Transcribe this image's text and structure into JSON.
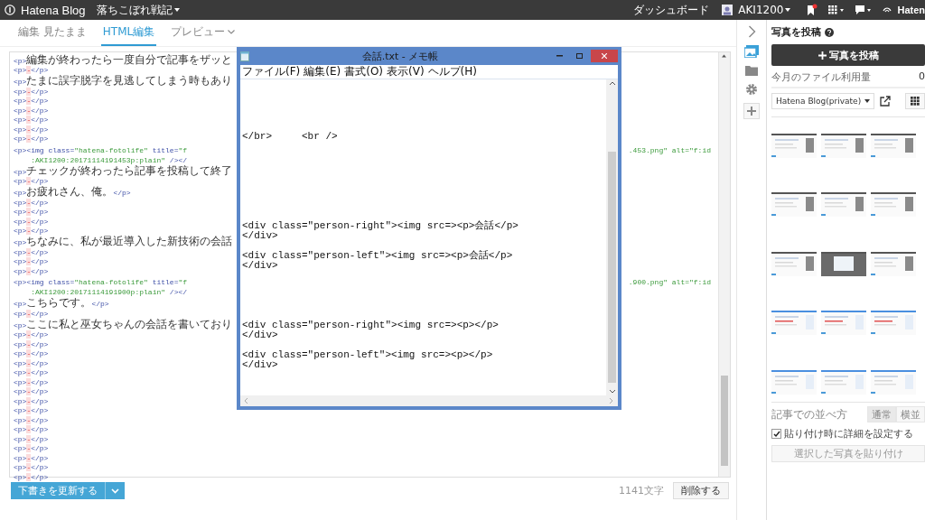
{
  "top_bar": {
    "logo": "Hatena Blog",
    "blog_title": "落ちこぼれ戦記",
    "dashboard": "ダッシュボード",
    "user": "AKI1200",
    "brand": "Haten",
    "notification": true
  },
  "tabs": [
    {
      "label": "編集 見たまま",
      "selected": false,
      "kind": "plain"
    },
    {
      "label": "HTML編集",
      "selected": true,
      "kind": "plain"
    },
    {
      "label": "プレビュー",
      "selected": false,
      "kind": "dropdown"
    }
  ],
  "editor": {
    "lines": [
      {
        "kind": "code",
        "text": "<p>編集が終わったら一度自分で記事をザッと"
      },
      {
        "kind": "blank",
        "text": "<p>-</p>"
      },
      {
        "kind": "code",
        "text": "<p>たまに誤字脱字を見逃してしまう時もあり"
      },
      {
        "kind": "blank",
        "text": "<p>-</p>"
      },
      {
        "kind": "blank",
        "text": "<p>-</p>"
      },
      {
        "kind": "blank",
        "text": "<p>-</p>"
      },
      {
        "kind": "blank",
        "text": "<p>-</p>"
      },
      {
        "kind": "blank",
        "text": "<p>-</p>"
      },
      {
        "kind": "blank",
        "text": "<p>-</p>"
      },
      {
        "kind": "code",
        "text": "<p><img class=\"hatena-fotolife\" title=\"f",
        "tail": ".453.png\" alt=\"f:id"
      },
      {
        "kind": "wrap",
        "text": "    :AKI1200:20171114191453p:plain\" /></"
      },
      {
        "kind": "code",
        "text": "<p>チェックが終わったら記事を投稿して終了"
      },
      {
        "kind": "blank",
        "text": "<p>-</p>"
      },
      {
        "kind": "code",
        "text": "<p>お疲れさん、俺。</p>"
      },
      {
        "kind": "blank",
        "text": "<p>-</p>"
      },
      {
        "kind": "blank",
        "text": "<p>-</p>"
      },
      {
        "kind": "blank",
        "text": "<p>-</p>"
      },
      {
        "kind": "blank",
        "text": "<p>-</p>"
      },
      {
        "kind": "code",
        "text": "<p>ちなみに、私が最近導入した新技術の会話"
      },
      {
        "kind": "blank",
        "text": "<p>-</p>"
      },
      {
        "kind": "blank",
        "text": "<p>-</p>"
      },
      {
        "kind": "blank",
        "text": "<p>-</p>"
      },
      {
        "kind": "code",
        "text": "<p><img class=\"hatena-fotolife\" title=\"f",
        "tail": ".900.png\" alt=\"f:id"
      },
      {
        "kind": "wrap",
        "text": "    :AKI1200:20171114191900p:plain\" /></"
      },
      {
        "kind": "code",
        "text": "<p>こちらです。</p>"
      },
      {
        "kind": "blank",
        "text": "<p>-</p>"
      },
      {
        "kind": "code",
        "text": "<p>ここに私と巫女ちゃんの会話を書いており"
      },
      {
        "kind": "blank",
        "text": "<p>-</p>"
      },
      {
        "kind": "blank",
        "text": "<p>-</p>"
      },
      {
        "kind": "blank",
        "text": "<p>-</p>"
      },
      {
        "kind": "blank",
        "text": "<p>-</p>"
      },
      {
        "kind": "blank",
        "text": "<p>-</p>"
      },
      {
        "kind": "blank",
        "text": "<p>-</p>"
      },
      {
        "kind": "blank",
        "text": "<p>-</p>"
      },
      {
        "kind": "blank",
        "text": "<p>-</p>"
      },
      {
        "kind": "blank",
        "text": "<p>-</p>"
      },
      {
        "kind": "blank",
        "text": "<p>-</p>"
      },
      {
        "kind": "blank",
        "text": "<p>-</p>"
      },
      {
        "kind": "blank",
        "text": "<p>-</p>"
      },
      {
        "kind": "blank",
        "text": "<p>-</p>"
      },
      {
        "kind": "blank",
        "text": "<p>-</p>"
      },
      {
        "kind": "blank",
        "text": "<p>-</p>"
      },
      {
        "kind": "blank",
        "text": "<p>-</p>"
      }
    ]
  },
  "footer": {
    "save_button": "下書きを更新する",
    "char_count": "1141文字",
    "delete_button": "削除する"
  },
  "notepad": {
    "title": "会話.txt - メモ帳",
    "menu": [
      "ファイル(F)",
      "編集(E)",
      "書式(O)",
      "表示(V)",
      "ヘルプ(H)"
    ],
    "content": "\n\n\n\n\n</br>     <br />\n\n\n\n\n\n\n\n\n<div class=\"person-right\"><img src=><p>会話</p>\n</div>\n\n<div class=\"person-left\"><img src=><p>会話</p>\n</div>\n\n\n\n\n\n<div class=\"person-right\"><img src=><p></p>\n</div>\n\n<div class=\"person-left\"><img src=><p></p>\n</div>"
  },
  "photo_panel": {
    "title": "写真を投稿",
    "upload_button": "写真を投稿",
    "usage_label": "今月のファイル利用量",
    "usage_value": "0",
    "album": "Hatena Blog(private)",
    "arrange_label": "記事での並べ方",
    "arrange_options": [
      {
        "label": "通常",
        "selected": true
      },
      {
        "label": "横並",
        "selected": false
      }
    ],
    "detail_checkbox": {
      "label": "貼り付け時に詳細を設定する",
      "checked": true
    },
    "paste_button": {
      "label": "選択した写真を貼り付け",
      "disabled": true
    }
  }
}
